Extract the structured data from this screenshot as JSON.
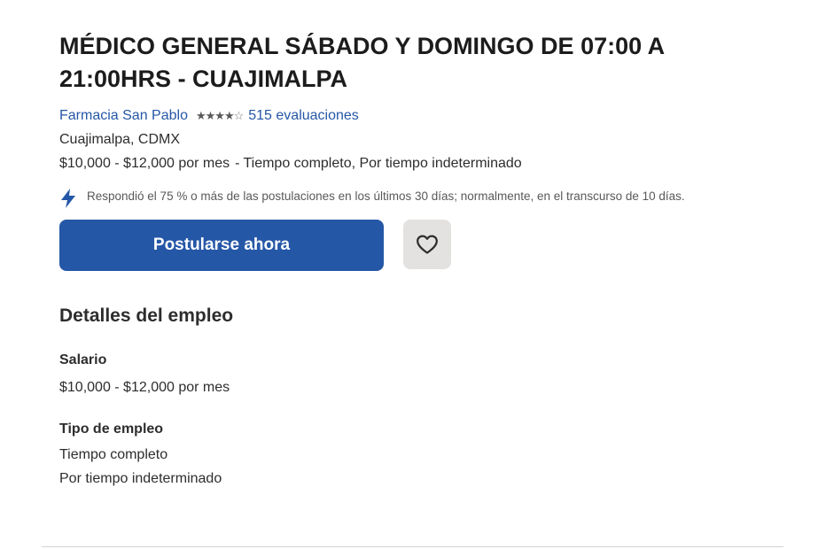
{
  "job": {
    "title": "MÉDICO GENERAL SÁBADO Y DOMINGO DE 07:00 A 21:00HRS - CUAJIMALPA",
    "company": "Farmacia San Pablo",
    "rating_value": 4,
    "rating_max": 5,
    "reviews_label": "515 evaluaciones",
    "location": "Cuajimalpa, CDMX",
    "salary": "$10,000 - $12,000 por mes",
    "job_types_inline": "Tiempo completo, Por tiempo indeterminado",
    "response_note": "Respondió el 75 % o más de las postulaciones en los últimos 30 días; normalmente, en el transcurso de 10 días."
  },
  "actions": {
    "apply_label": "Postularse ahora",
    "save_icon": "heart-outline-icon"
  },
  "details": {
    "section_title": "Detalles del empleo",
    "salary_label": "Salario",
    "salary_value": "$10,000 - $12,000 por mes",
    "type_label": "Tipo de empleo",
    "types": [
      "Tiempo completo",
      "Por tiempo indeterminado"
    ]
  },
  "colors": {
    "accent": "#2557a7",
    "text": "#2d2d2d",
    "muted": "#595959",
    "save_bg": "#e4e2e0",
    "divider": "#d4d2d0"
  }
}
